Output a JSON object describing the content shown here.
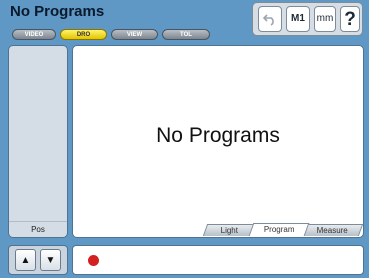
{
  "header": {
    "title": "No Programs"
  },
  "tabs": [
    {
      "label": "VIDEO",
      "active": false
    },
    {
      "label": "DRO",
      "active": true
    },
    {
      "label": "VIEW",
      "active": false
    },
    {
      "label": "TOL",
      "active": false
    }
  ],
  "toolbar": {
    "undo_icon": "undo-arrow-icon",
    "m1_label": "M1",
    "units_label": "mm",
    "help_label": "?"
  },
  "left_panel": {
    "label": "Pos"
  },
  "main": {
    "message": "No Programs",
    "subtabs": [
      {
        "label": "Light",
        "active": false
      },
      {
        "label": "Program",
        "active": true
      },
      {
        "label": "Measure",
        "active": false
      }
    ]
  },
  "nav": {
    "up_icon": "arrow-up-icon",
    "down_icon": "arrow-down-icon"
  },
  "command_bar": {
    "record_color": "#d32020"
  },
  "colors": {
    "background": "#5f98c4",
    "active_tab": "#f2dc2a"
  }
}
